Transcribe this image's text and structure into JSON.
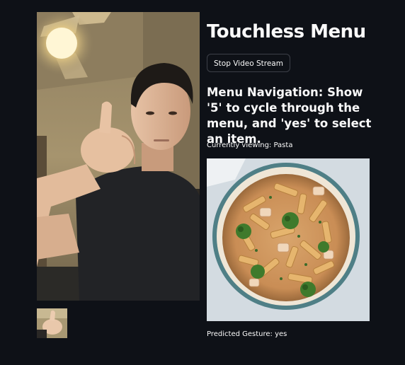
{
  "app": {
    "title": "Touchless Menu"
  },
  "controls": {
    "stream_button_label": "Stop Video Stream"
  },
  "instructions": {
    "text": "Menu Navigation: Show '5' to cycle through the menu, and 'yes' to select an item."
  },
  "status": {
    "currently_viewing": "Currently viewing: Pasta",
    "predicted_gesture": "Predicted Gesture: yes"
  },
  "media": {
    "webcam_feed": "webcam-feed",
    "gesture_thumbnail": "gesture-thumbnail",
    "menu_item_image": "pasta-dish"
  },
  "colors": {
    "background": "#0e1117",
    "text": "#fafafa",
    "button_border": "#3d4048"
  }
}
